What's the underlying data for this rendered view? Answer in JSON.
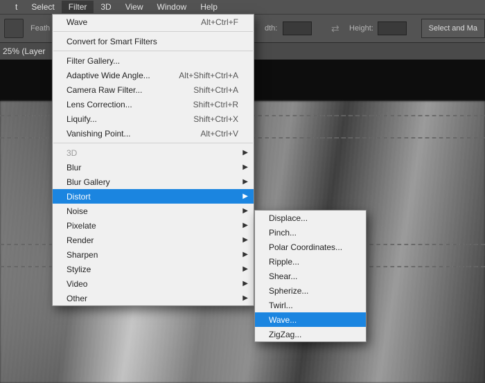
{
  "menubar": {
    "edit_fragment": "t",
    "select": "Select",
    "filter": "Filter",
    "three_d": "3D",
    "view": "View",
    "window": "Window",
    "help": "Help"
  },
  "options": {
    "feather_fragment": "Feath",
    "width_fragment": "dth:",
    "height_label": "Height:",
    "select_mask_fragment": "Select and Ma"
  },
  "doc": {
    "title_fragment": "25% (Layer"
  },
  "filter_menu": {
    "last": {
      "label": "Wave",
      "accel": "Alt+Ctrl+F"
    },
    "convert": "Convert for Smart Filters",
    "group2": [
      {
        "label": "Filter Gallery...",
        "accel": ""
      },
      {
        "label": "Adaptive Wide Angle...",
        "accel": "Alt+Shift+Ctrl+A"
      },
      {
        "label": "Camera Raw Filter...",
        "accel": "Shift+Ctrl+A"
      },
      {
        "label": "Lens Correction...",
        "accel": "Shift+Ctrl+R"
      },
      {
        "label": "Liquify...",
        "accel": "Shift+Ctrl+X"
      },
      {
        "label": "Vanishing Point...",
        "accel": "Alt+Ctrl+V"
      }
    ],
    "group3": [
      {
        "label": "3D",
        "disabled": true
      },
      {
        "label": "Blur"
      },
      {
        "label": "Blur Gallery"
      },
      {
        "label": "Distort",
        "highlight": true
      },
      {
        "label": "Noise"
      },
      {
        "label": "Pixelate"
      },
      {
        "label": "Render"
      },
      {
        "label": "Sharpen"
      },
      {
        "label": "Stylize"
      },
      {
        "label": "Video"
      },
      {
        "label": "Other"
      }
    ]
  },
  "distort_menu": [
    {
      "label": "Displace..."
    },
    {
      "label": "Pinch..."
    },
    {
      "label": "Polar Coordinates..."
    },
    {
      "label": "Ripple..."
    },
    {
      "label": "Shear..."
    },
    {
      "label": "Spherize..."
    },
    {
      "label": "Twirl..."
    },
    {
      "label": "Wave...",
      "highlight": true
    },
    {
      "label": "ZigZag..."
    }
  ]
}
